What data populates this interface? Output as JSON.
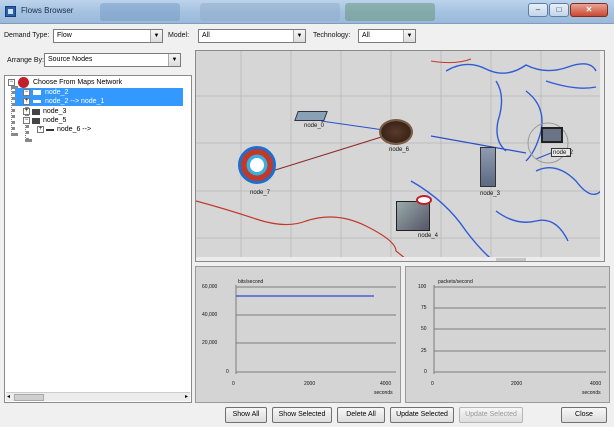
{
  "window": {
    "title": "Flows Browser",
    "minimize": "–",
    "maximize": "□",
    "close": "✕"
  },
  "filters": {
    "demand_type_label": "Demand Type:",
    "demand_type_value": "Flow",
    "model_label": "Model:",
    "model_value": "All",
    "technology_label": "Technology:",
    "technology_value": "All"
  },
  "arrange": {
    "label": "Arrange By:",
    "value": "Source Nodes"
  },
  "tree": {
    "root": "Choose From Maps Network",
    "items": [
      "node_2",
      "node_2 --> node_1",
      "node_3",
      "node_5",
      "node_6 --> "
    ]
  },
  "map": {
    "nodes": [
      "node_0",
      "node_6",
      "node_7",
      "node_3",
      "node_2",
      "node_4"
    ],
    "colors": {
      "map_bg": "#d6d6d6",
      "grid": "#b8b8b8",
      "water": "#2f5bd6",
      "border": "#c0392b",
      "flow": "#2a50c8"
    },
    "icons": [
      "router-icon",
      "workstation-icon",
      "server-icon",
      "hub-icon",
      "rack-icon"
    ]
  },
  "graph1": {
    "title": "bits/second",
    "yticks": [
      "60,000",
      "40,000",
      "20,000",
      "0"
    ],
    "xticks": [
      "0",
      "2000",
      "4000"
    ],
    "xunit": "seconds"
  },
  "graph2": {
    "title": "packets/second",
    "yticks": [
      "100",
      "75",
      "50",
      "25",
      "0"
    ],
    "xticks": [
      "0",
      "2000",
      "4000"
    ],
    "xunit": "seconds"
  },
  "buttons": {
    "show_all": "Show All",
    "show_selected": "Show Selected",
    "delete_all": "Delete All",
    "update_selected": "Update Selected",
    "update_selected_2": "Update Selected",
    "close": "Close"
  }
}
